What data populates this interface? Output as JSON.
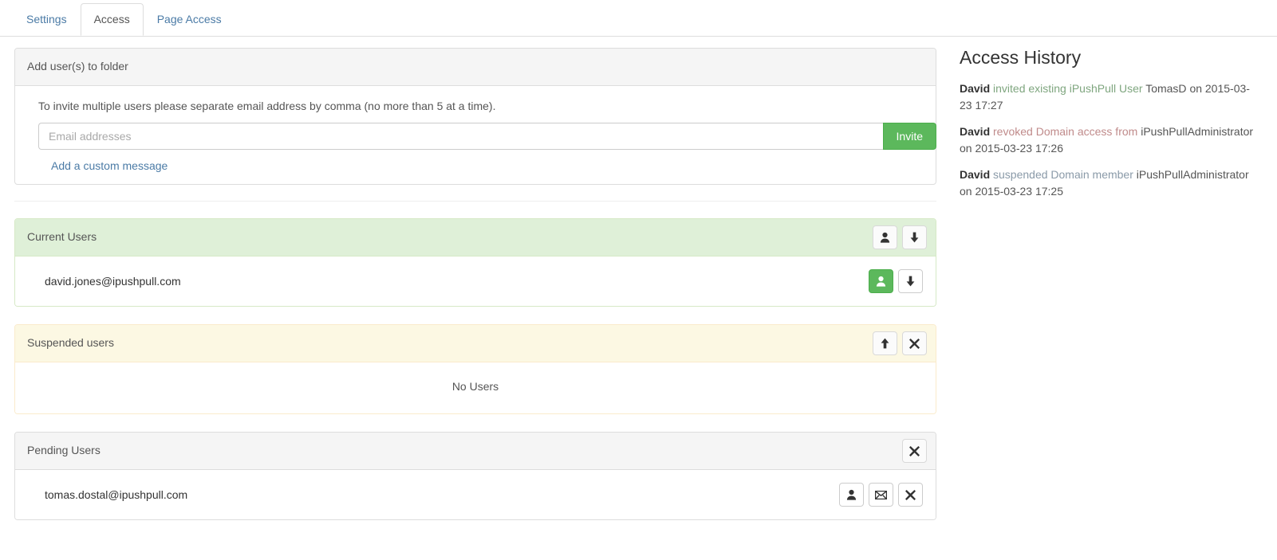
{
  "tabs": [
    {
      "label": "Settings",
      "active": false
    },
    {
      "label": "Access",
      "active": true
    },
    {
      "label": "Page Access",
      "active": false
    }
  ],
  "add_users": {
    "heading": "Add user(s) to folder",
    "hint": "To invite multiple users please separate email address by comma (no more than 5 at a time).",
    "email_placeholder": "Email addresses",
    "email_value": "",
    "invite_label": "Invite",
    "custom_message_link": "Add a custom message"
  },
  "current_users": {
    "heading": "Current Users",
    "header_actions": [
      "person-icon",
      "arrow-down-icon"
    ],
    "rows": [
      {
        "email": "david.jones@ipushpull.com",
        "actions": [
          "person-icon",
          "arrow-down-icon"
        ]
      }
    ]
  },
  "suspended_users": {
    "heading": "Suspended users",
    "header_actions": [
      "arrow-up-icon",
      "close-icon"
    ],
    "empty_text": "No Users"
  },
  "pending_users": {
    "heading": "Pending Users",
    "header_actions": [
      "close-icon"
    ],
    "rows": [
      {
        "email": "tomas.dostal@ipushpull.com",
        "actions": [
          "person-icon",
          "envelope-icon",
          "close-icon"
        ]
      }
    ]
  },
  "access_history": {
    "title": "Access History",
    "entries": [
      {
        "actor": "David",
        "action": "invited existing iPushPull User",
        "action_type": "invited",
        "target": "TomasD",
        "when": "on 2015-03-23 17:27"
      },
      {
        "actor": "David",
        "action": "revoked Domain access from",
        "action_type": "revoked",
        "target": "iPushPullAdministrator",
        "when": "on 2015-03-23 17:26"
      },
      {
        "actor": "David",
        "action": "suspended Domain member",
        "action_type": "suspended",
        "target": "iPushPullAdministrator",
        "when": "on 2015-03-23 17:25"
      }
    ]
  },
  "colors": {
    "success": "#5cb85c",
    "panel_green": "#dff0d8",
    "panel_yellow": "#fcf8e3",
    "panel_gray": "#f5f5f5",
    "link": "#4b7ba6"
  }
}
